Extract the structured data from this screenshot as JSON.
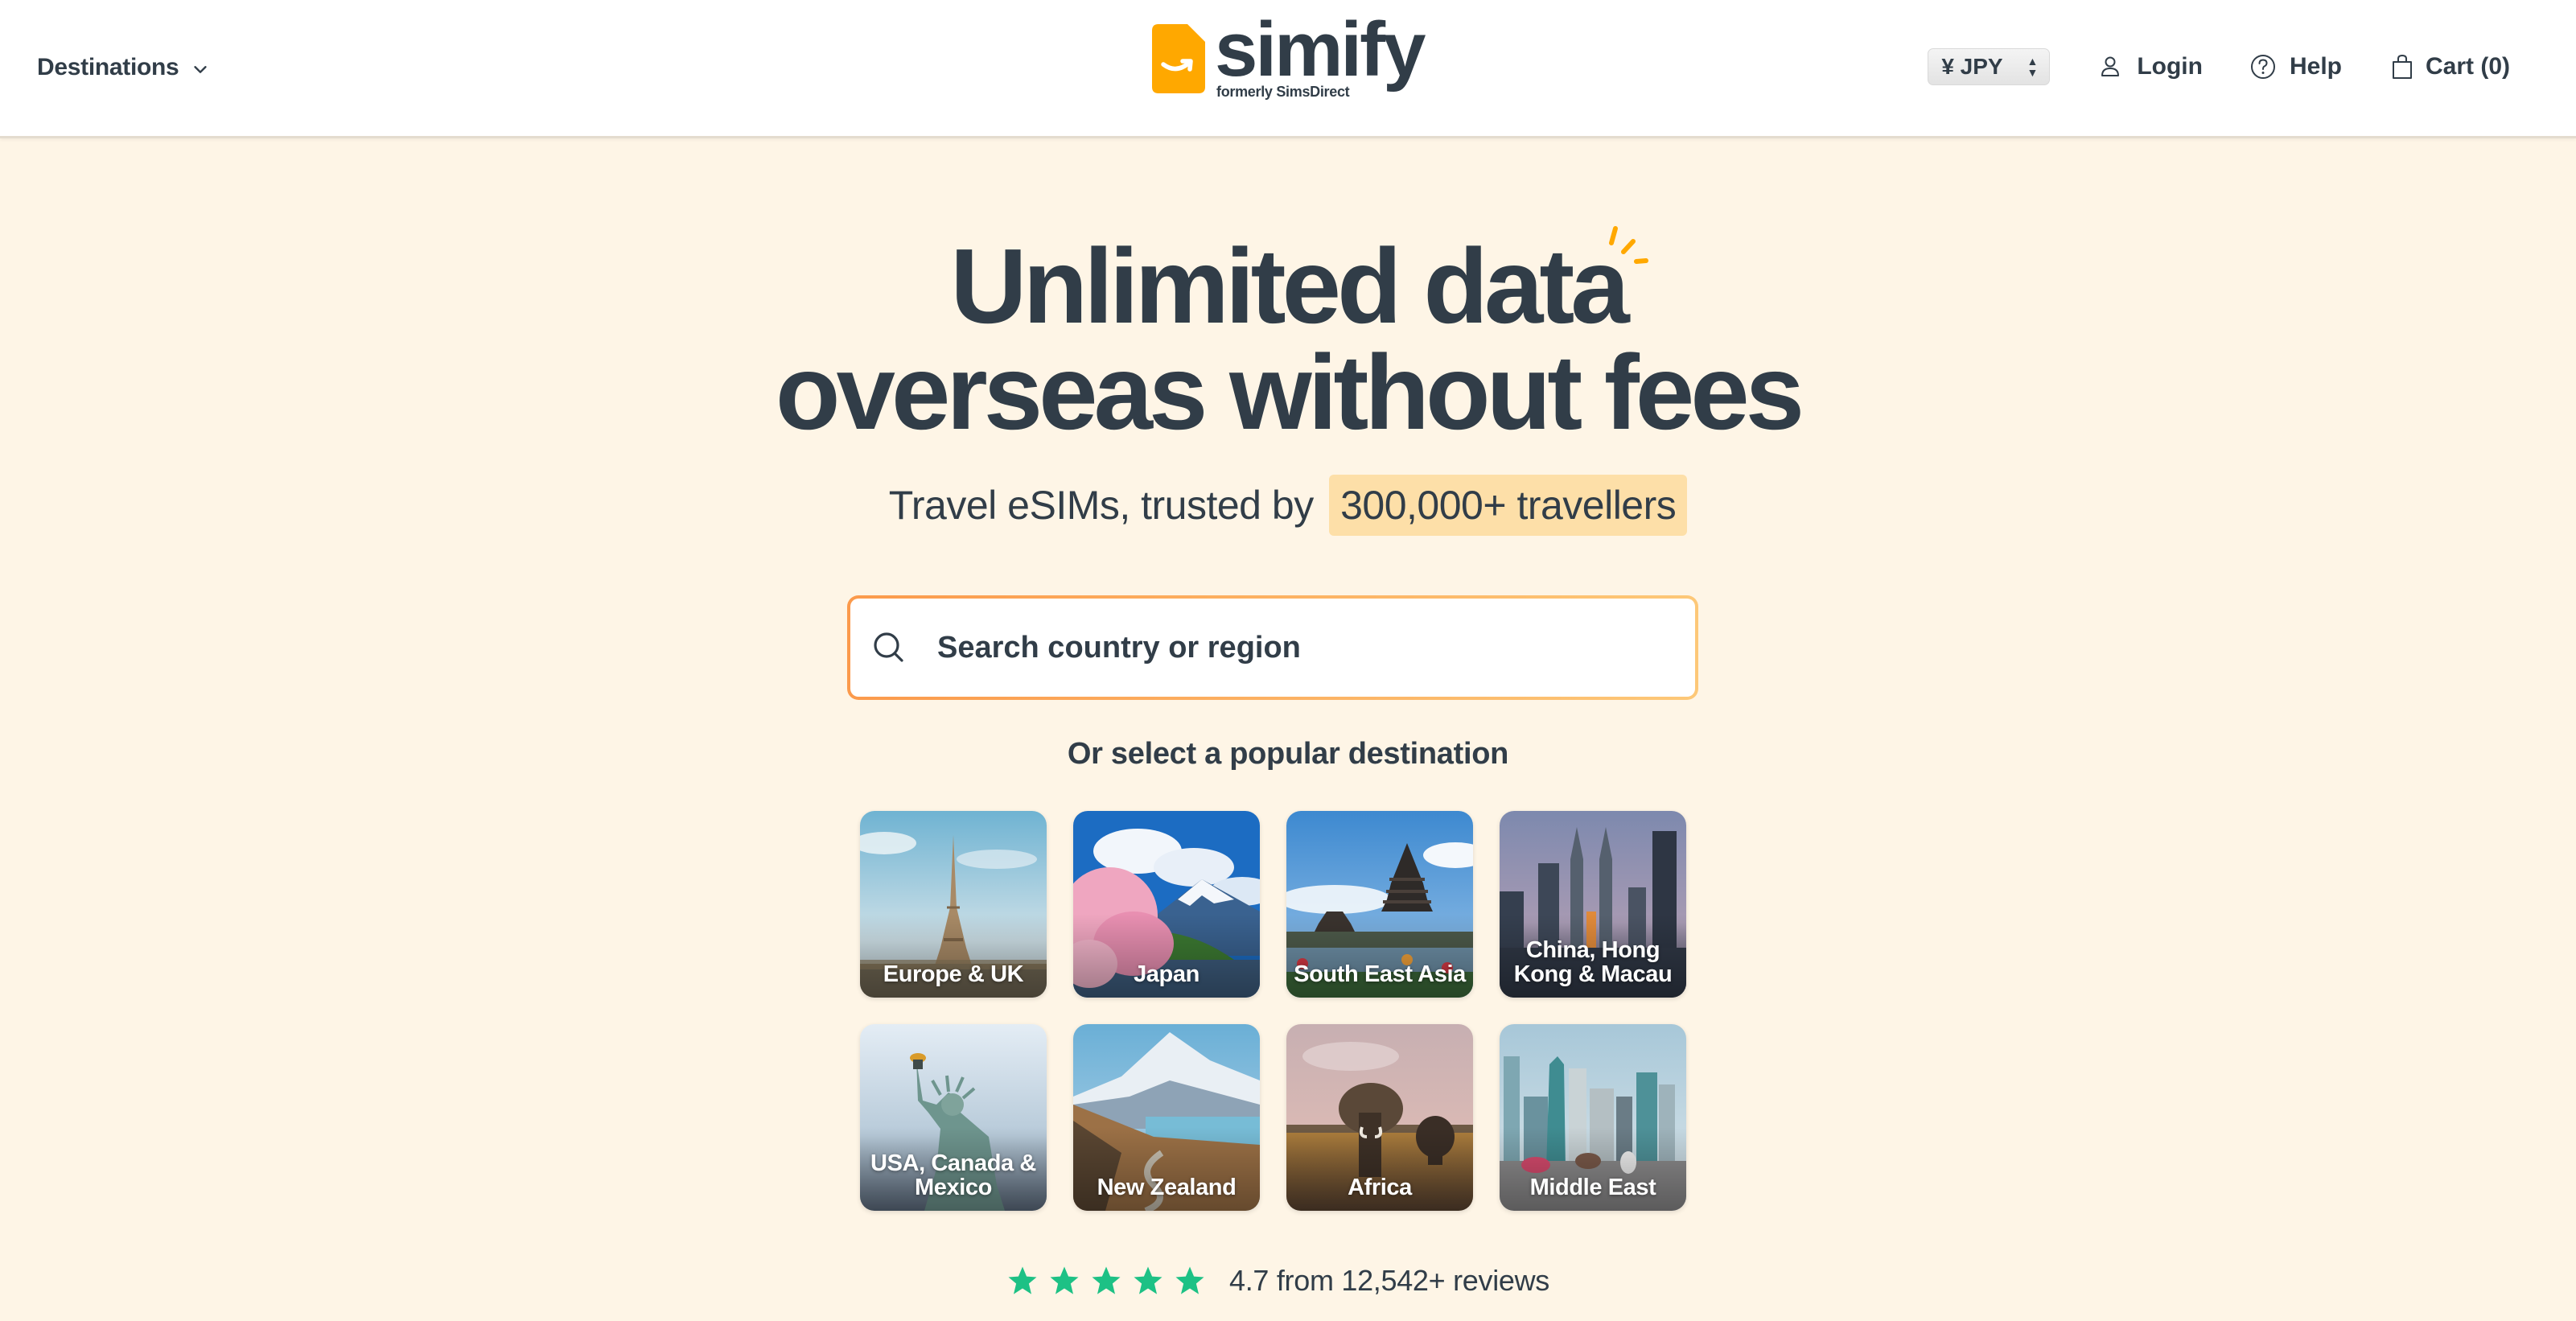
{
  "header": {
    "destinations_label": "Destinations",
    "logo": {
      "wordmark": "simify",
      "subtitle": "formerly SimsDirect",
      "brand_color": "#FFA800"
    },
    "currency": {
      "selected": "¥ JPY"
    },
    "login_label": "Login",
    "help_label": "Help",
    "cart_label": "Cart (0)"
  },
  "hero": {
    "title_line1": "Unlimited data",
    "title_line2": "overseas without fees",
    "subtitle_prefix": "Travel eSIMs, trusted by",
    "subtitle_highlight": "300,000+ travellers",
    "highlight_color": "#FDDFA8",
    "accent_color": "#FFA800"
  },
  "search": {
    "placeholder": "Search country or region",
    "value": ""
  },
  "popular": {
    "label": "Or select a popular destination",
    "destinations": [
      {
        "label": "Europe & UK",
        "scene": "eiffel-tower"
      },
      {
        "label": "Japan",
        "scene": "mount-fuji-cherry-blossom"
      },
      {
        "label": "South East Asia",
        "scene": "bali-temple"
      },
      {
        "label": "China, Hong Kong & Macau",
        "scene": "city-skyline-twin-towers"
      },
      {
        "label": "USA, Canada & Mexico",
        "scene": "statue-of-liberty"
      },
      {
        "label": "New Zealand",
        "scene": "mountain-lake-road"
      },
      {
        "label": "Africa",
        "scene": "elephants-savanna"
      },
      {
        "label": "Middle East",
        "scene": "dubai-skyline-camels"
      }
    ]
  },
  "rating": {
    "stars": 5,
    "star_color": "#1DC185",
    "text": "4.7 from 12,542+ reviews"
  },
  "colors": {
    "text": "#313D48",
    "background": "#FEF5E6"
  }
}
